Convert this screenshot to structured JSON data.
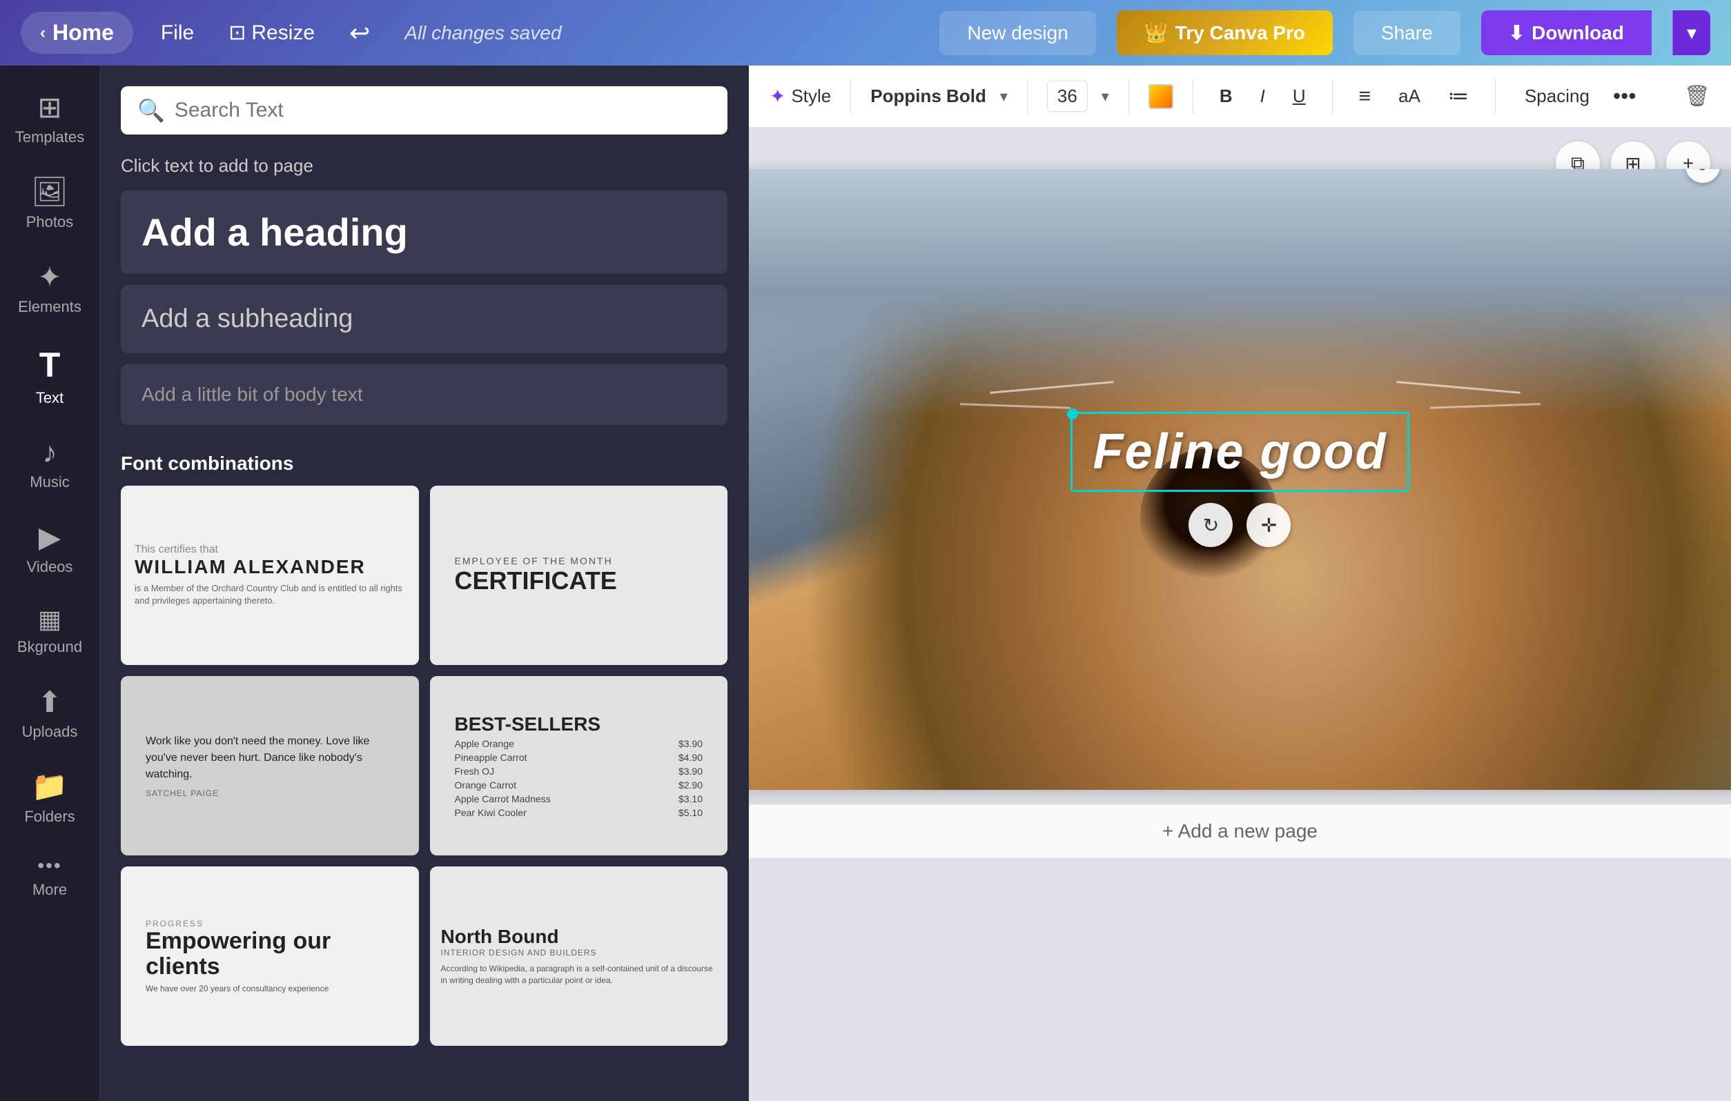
{
  "nav": {
    "home_label": "Home",
    "file_label": "File",
    "resize_label": "Resize",
    "saved_status": "All changes saved",
    "new_design_label": "New design",
    "try_pro_label": "Try Canva Pro",
    "share_label": "Share",
    "download_label": "Download"
  },
  "sidebar": {
    "items": [
      {
        "id": "templates",
        "label": "Templates",
        "icon": "⊞"
      },
      {
        "id": "photos",
        "label": "Photos",
        "icon": "🖼"
      },
      {
        "id": "elements",
        "label": "Elements",
        "icon": "✦"
      },
      {
        "id": "text",
        "label": "Text",
        "icon": "T"
      },
      {
        "id": "music",
        "label": "Music",
        "icon": "♪"
      },
      {
        "id": "videos",
        "label": "Videos",
        "icon": "▶"
      },
      {
        "id": "background",
        "label": "Bkground",
        "icon": "⬜"
      },
      {
        "id": "uploads",
        "label": "Uploads",
        "icon": "↑"
      },
      {
        "id": "folders",
        "label": "Folders",
        "icon": "📁"
      },
      {
        "id": "more",
        "label": "More",
        "icon": "•••"
      }
    ]
  },
  "text_panel": {
    "search_placeholder": "Search Text",
    "click_hint": "Click text to add to page",
    "heading_label": "Add a heading",
    "subheading_label": "Add a subheading",
    "body_label": "Add a little bit of body text",
    "font_combos_title": "Font combinations",
    "font_combos": [
      {
        "id": "fc1",
        "type": "certificate",
        "line1": "This certifies that",
        "line2": "WILLIAM ALEXANDER",
        "line3": "is a Member of the Orchard Country Club and is entitled to all rights and privileges appertaining thereto."
      },
      {
        "id": "fc2",
        "type": "employee",
        "line1": "EMPLOYEE OF THE MONTH",
        "line2": "CERTIFICATE"
      },
      {
        "id": "fc3",
        "type": "quote",
        "line1": "Work like you don't need the money. Love like you've never been hurt. Dance like nobody's watching.",
        "line2": "SATCHEL PAIGE"
      },
      {
        "id": "fc4",
        "type": "menu",
        "line1": "BEST-SELLERS",
        "items": [
          {
            "name": "Apple Orange",
            "price": "$3.90"
          },
          {
            "name": "Pineapple Carrot",
            "price": "$4.90"
          },
          {
            "name": "Fresh OJ",
            "price": "$3.90"
          },
          {
            "name": "Orange Carrot",
            "price": "$2.90"
          },
          {
            "name": "Apple Carrot Madness",
            "price": "$3.10"
          },
          {
            "name": "Pear Kiwi Cooler",
            "price": "$5.10"
          }
        ]
      },
      {
        "id": "fc5",
        "type": "progress",
        "label": "PROGRESS",
        "title": "Empowering our clients",
        "body": "We have over 20 years of consultancy experience"
      },
      {
        "id": "fc6",
        "type": "northbound",
        "title": "North Bound",
        "subtitle": "INTERIOR DESIGN AND BUILDERS",
        "body": "According to Wikipedia, a paragraph is a self-contained unit of a discourse in writing dealing with a particular point or idea. A paragraph consists of one or more sentences. Though not required by the syntax of any language, paragraphs are usually an expected..."
      }
    ]
  },
  "toolbar": {
    "style_label": "Style",
    "font_name": "Poppins Bold",
    "font_size": "36",
    "bold_label": "B",
    "italic_label": "I",
    "underline_label": "U",
    "align_label": "≡",
    "case_label": "aA",
    "list_label": "≔",
    "spacing_label": "Spacing",
    "more_label": "•••"
  },
  "canvas": {
    "text_content": "Feline good",
    "add_page_label": "+ Add a new page"
  }
}
